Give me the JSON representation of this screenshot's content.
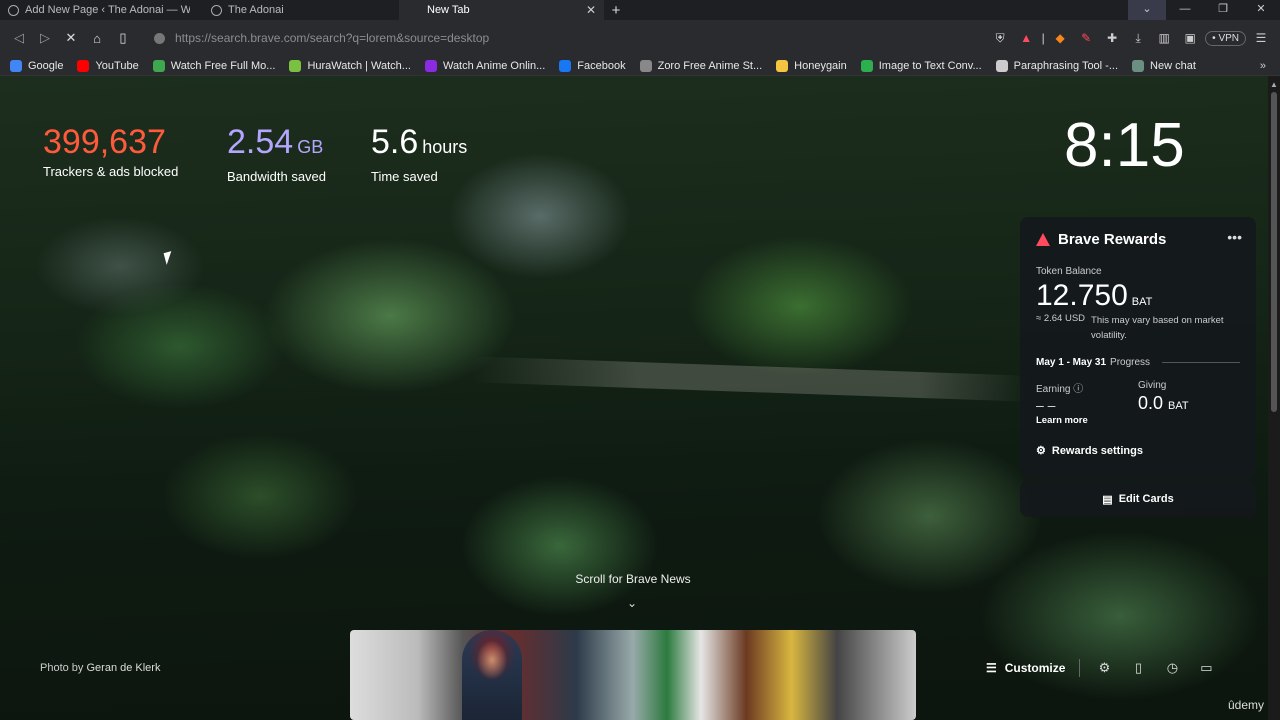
{
  "tabs": [
    {
      "title": "Add New Page ‹ The Adonai — WordPress",
      "active": false
    },
    {
      "title": "The Adonai",
      "active": false
    },
    {
      "title": "New Tab",
      "active": true
    }
  ],
  "new_tab_symbol": "+",
  "url": "https://search.brave.com/search?q=lorem&source=desktop",
  "vpn_label": "VPN",
  "bookmarks": [
    {
      "label": "Google",
      "icon": "google-icon",
      "color": "#4285f4"
    },
    {
      "label": "YouTube",
      "icon": "youtube-icon",
      "color": "#ff0000"
    },
    {
      "label": "Watch Free Full Mo...",
      "icon": "movie-icon",
      "color": "#3ea84f"
    },
    {
      "label": "HuraWatch | Watch...",
      "icon": "hurawatch-icon",
      "color": "#7ac142"
    },
    {
      "label": "Watch Anime Onlin...",
      "icon": "anime-icon",
      "color": "#8a2be2"
    },
    {
      "label": "Facebook",
      "icon": "facebook-icon",
      "color": "#1877f2"
    },
    {
      "label": "Zoro Free Anime St...",
      "icon": "zoro-icon",
      "color": "#888888"
    },
    {
      "label": "Honeygain",
      "icon": "honeygain-icon",
      "color": "#f5c542"
    },
    {
      "label": "Image to Text Conv...",
      "icon": "image-text-icon",
      "color": "#2eaf4f"
    },
    {
      "label": "Paraphrasing Tool -...",
      "icon": "quill-icon",
      "color": "#cccccc"
    },
    {
      "label": "New chat",
      "icon": "chat-icon",
      "color": "#6b8f80"
    }
  ],
  "stats": {
    "trackers_value": "399,637",
    "trackers_label": "Trackers & ads blocked",
    "bandwidth_value": "2.54",
    "bandwidth_unit": "GB",
    "bandwidth_label": "Bandwidth saved",
    "time_value": "5.6",
    "time_unit": "hours",
    "time_label": "Time saved"
  },
  "clock": "8:15",
  "rewards": {
    "title": "Brave Rewards",
    "token_label": "Token Balance",
    "balance": "12.750",
    "balance_unit": "BAT",
    "usd": "≈ 2.64 USD",
    "usd_note": "This may vary based on market volatility.",
    "period": "May 1 - May 31",
    "progress_label": "Progress",
    "earning_label": "Earning",
    "earning_value": "– –",
    "learn_more": "Learn more",
    "giving_label": "Giving",
    "giving_value": "0.0",
    "giving_unit": "BAT",
    "settings_label": "Rewards settings",
    "edit_cards": "Edit Cards"
  },
  "scroll_news": "Scroll for Brave News",
  "photo_credit_prefix": "Photo by",
  "photo_credit_author": "Geran de Klerk",
  "customize_label": "Customize",
  "watermark": "ûdemy",
  "colors": {
    "trackers": "#ff5a3c",
    "bandwidth": "#b4a6ff",
    "brave": "#ff4a5f"
  }
}
